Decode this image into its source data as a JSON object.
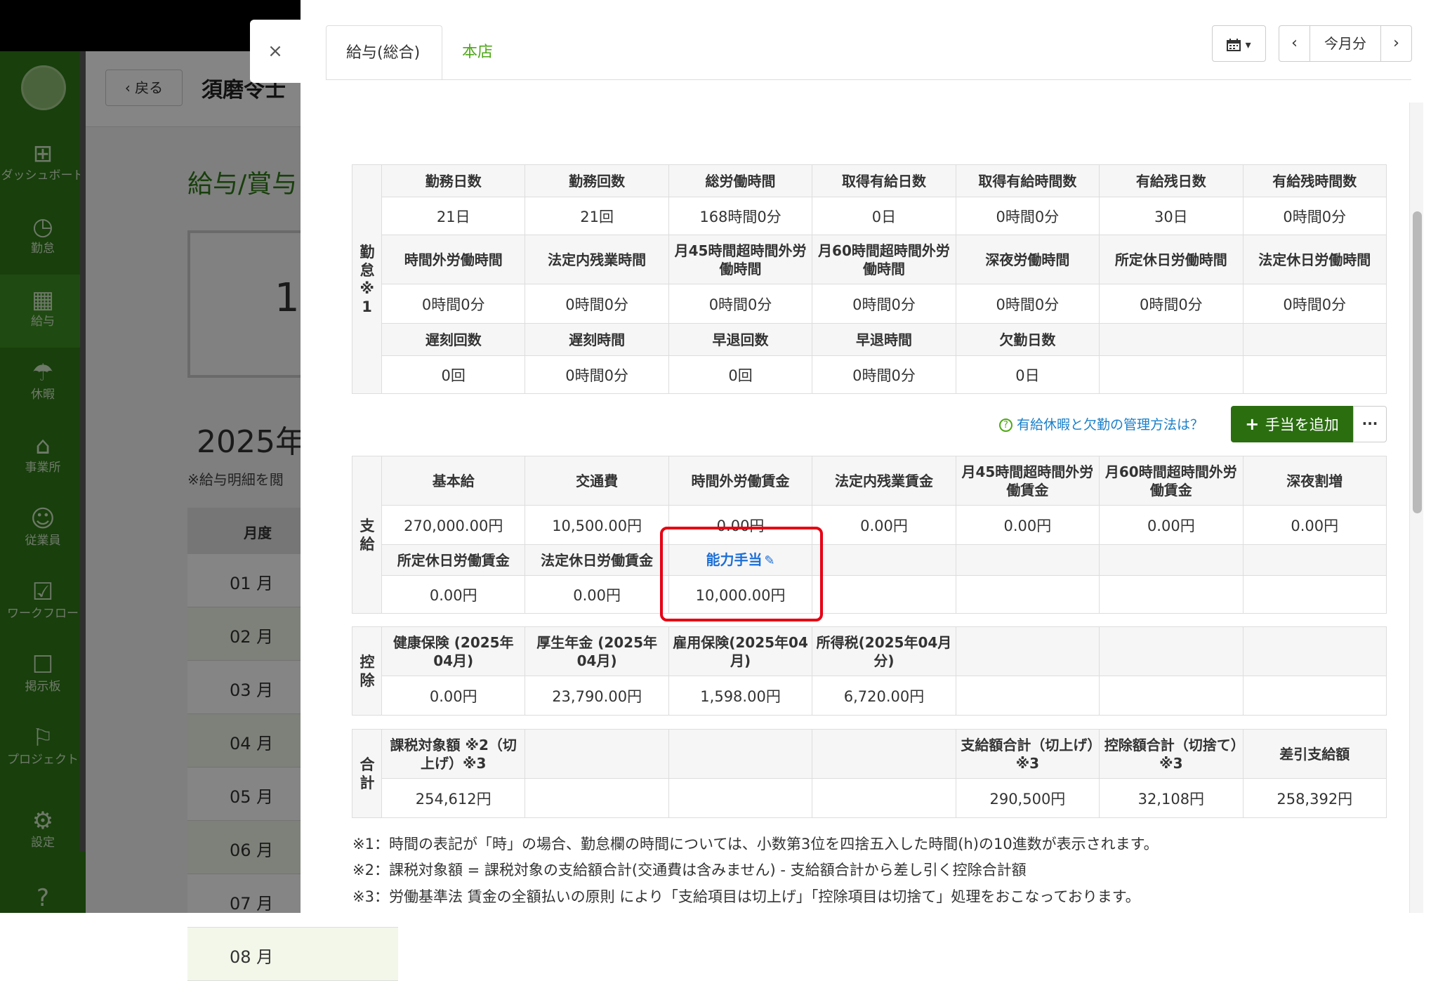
{
  "background": {
    "sidebar": [
      {
        "label": "ダッシュボード",
        "icon": "dashboard-icon"
      },
      {
        "label": "勤怠",
        "icon": "clock-icon"
      },
      {
        "label": "給与",
        "icon": "calculator-icon"
      },
      {
        "label": "休暇",
        "icon": "umbrella-icon"
      },
      {
        "label": "事業所",
        "icon": "home-icon"
      },
      {
        "label": "従業員",
        "icon": "user-icon"
      },
      {
        "label": "ワークフロー",
        "icon": "workflow-icon"
      },
      {
        "label": "掲示板",
        "icon": "chat-icon"
      },
      {
        "label": "プロジェクト",
        "icon": "flag-icon"
      },
      {
        "label": "設定",
        "icon": "gear-icon"
      }
    ],
    "back_label": "戻る",
    "employee_name": "須磨令士",
    "page_title": "給与/賞与",
    "card_value": "1",
    "year": "2025年",
    "note": "※給与明細を閲",
    "month_header": "月度",
    "months": [
      "01 月",
      "02 月",
      "03 月",
      "04 月",
      "05 月",
      "06 月",
      "07 月",
      "08 月"
    ]
  },
  "modal": {
    "close_icon": "×",
    "tabs": [
      "給与(総合)",
      "本店"
    ],
    "period_label": "今月分",
    "prev": "‹",
    "next": "›",
    "calendar_caret": "▾"
  },
  "attendance": {
    "side_label": "勤怠※1",
    "row1_headers": [
      "勤務日数",
      "勤務回数",
      "総労働時間",
      "取得有給日数",
      "取得有給時間数",
      "有給残日数",
      "有給残時間数"
    ],
    "row1_values": [
      "21日",
      "21回",
      "168時間0分",
      "0日",
      "0時間0分",
      "30日",
      "0時間0分"
    ],
    "row2_headers": [
      "時間外労働時間",
      "法定内残業時間",
      "月45時間超時間外労働時間",
      "月60時間超時間外労働時間",
      "深夜労働時間",
      "所定休日労働時間",
      "法定休日労働時間"
    ],
    "row2_values": [
      "0時間0分",
      "0時間0分",
      "0時間0分",
      "0時間0分",
      "0時間0分",
      "0時間0分",
      "0時間0分"
    ],
    "row3_headers": [
      "遅刻回数",
      "遅刻時間",
      "早退回数",
      "早退時間",
      "欠勤日数",
      "",
      ""
    ],
    "row3_values": [
      "0回",
      "0時間0分",
      "0回",
      "0時間0分",
      "0日",
      "",
      ""
    ]
  },
  "help_link": "有給休暇と欠勤の管理方法は？",
  "add_allowance_button": "手当を追加",
  "more_button": "···",
  "payment": {
    "side_label": "支給",
    "row1_headers": [
      "基本給",
      "交通費",
      "時間外労働賃金",
      "法定内残業賃金",
      "月45時間超時間外労働賃金",
      "月60時間超時間外労働賃金",
      "深夜割増"
    ],
    "row1_values": [
      "270,000.00円",
      "10,500.00円",
      "0.00円",
      "0.00円",
      "0.00円",
      "0.00円",
      "0.00円"
    ],
    "row2_headers": [
      "所定休日労働賃金",
      "法定休日労働賃金",
      "能力手当",
      "",
      "",
      "",
      ""
    ],
    "row2_values": [
      "0.00円",
      "0.00円",
      "10,000.00円",
      "",
      "",
      "",
      ""
    ]
  },
  "deduction": {
    "side_label": "控除",
    "headers": [
      "健康保険 (2025年04月)",
      "厚生年金 (2025年04月)",
      "雇用保険(2025年04月)",
      "所得税(2025年04月分)",
      "",
      "",
      ""
    ],
    "values": [
      "0.00円",
      "23,790.00円",
      "1,598.00円",
      "6,720.00円",
      "",
      "",
      ""
    ]
  },
  "total": {
    "side_label": "合計",
    "headers": [
      "課税対象額 ※2（切上げ）※3",
      "",
      "",
      "",
      "支給額合計（切上げ）※3",
      "控除額合計（切捨て）※3",
      "差引支給額"
    ],
    "values": [
      "254,612円",
      "",
      "",
      "",
      "290,500円",
      "32,108円",
      "258,392円"
    ]
  },
  "footnotes": [
    "※1：時間の表記が「時」の場合、勤怠欄の時間については、小数第3位を四捨五入した時間(h)の10進数が表示されます。",
    "※2：課税対象額 = 課税対象の支給額合計(交通費は含みません) - 支給額合計から差し引く控除合計額",
    "※3：労働基準法 賃金の全額払いの原則 により「支給項目は切上げ」「控除項目は切捨て」処理をおこなっております。"
  ]
}
